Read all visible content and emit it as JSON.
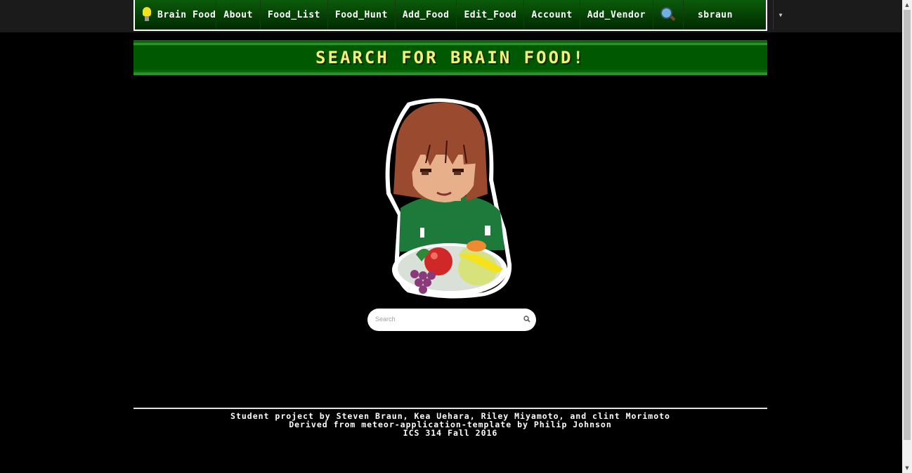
{
  "navbar": {
    "brand_label": "Brain Food",
    "items": [
      {
        "label": "About"
      },
      {
        "label": "Food_List"
      },
      {
        "label": "Food_Hunt"
      },
      {
        "label": "Add_Food"
      },
      {
        "label": "Edit_Food"
      },
      {
        "label": "Account"
      },
      {
        "label": "Add_Vendor"
      }
    ],
    "search_icon": "magnifier-icon",
    "user_label": "sbraun",
    "dropdown_icon": "caret-down-icon"
  },
  "banner": {
    "title": "SEARCH FOR BRAIN FOOD!"
  },
  "hero": {
    "illustration": "pixel-art girl holding fruit bowl"
  },
  "search": {
    "placeholder": "Search",
    "value": "",
    "icon": "search-icon"
  },
  "footer": {
    "line1": "Student project by Steven Braun, Kea Uehara, Riley Miyamoto, and clint Morimoto",
    "line2": "Derived from meteor-application-template by Philip Johnson",
    "line3": "ICS 314 Fall 2016"
  },
  "colors": {
    "page_background": "#000000",
    "nav_green": "#0b5a0b",
    "banner_green": "#005800",
    "banner_text": "#f4f07a"
  }
}
